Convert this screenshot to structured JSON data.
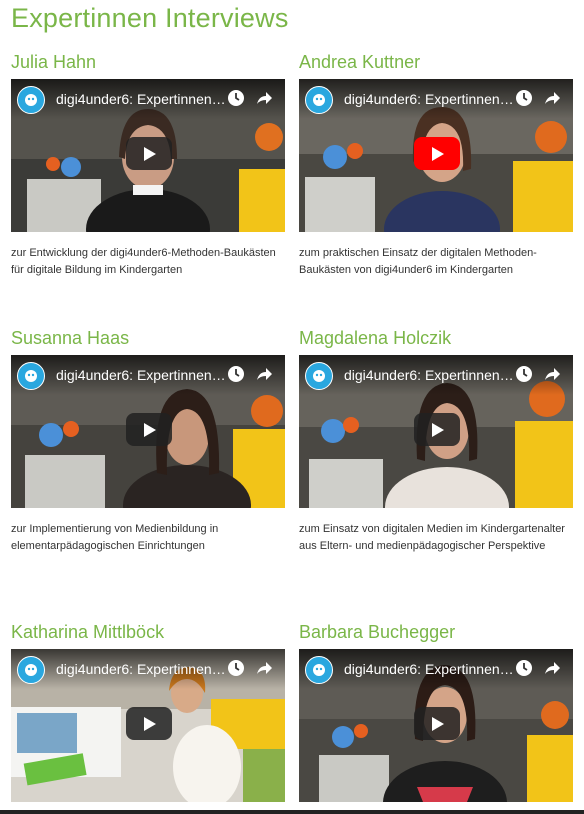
{
  "page": {
    "title": "Expertinnen Interviews"
  },
  "video_title": "digi4under6: Expertinnen-...",
  "icons": {
    "channel": "digi4under6-channel-logo-icon",
    "watch_later": "clock-icon",
    "share": "share-arrow-icon",
    "play": "play-icon"
  },
  "colors": {
    "accent_green": "#7ab648",
    "play_active": "#ff0000",
    "channel_blue": "#2aa7df"
  },
  "interviews": [
    {
      "name": "Julia Hahn",
      "description": "zur Entwicklung der digi4under6-Methoden-Baukästen für digitale Bildung im Kindergarten"
    },
    {
      "name": "Andrea Kuttner",
      "description": "zum praktischen Einsatz der digitalen Methoden-Baukästen von digi4under6 im Kindergarten"
    },
    {
      "name": "Susanna Haas",
      "description": "zur Implementierung von Medienbildung in elementarpädagogischen Einrichtungen"
    },
    {
      "name": "Magdalena Holczik",
      "description": "zum Einsatz von digitalen Medien im Kindergartenalter aus Eltern- und medienpädagogischer Perspektive"
    },
    {
      "name": "Katharina Mittlböck",
      "description": ""
    },
    {
      "name": "Barbara Buchegger",
      "description": ""
    }
  ]
}
